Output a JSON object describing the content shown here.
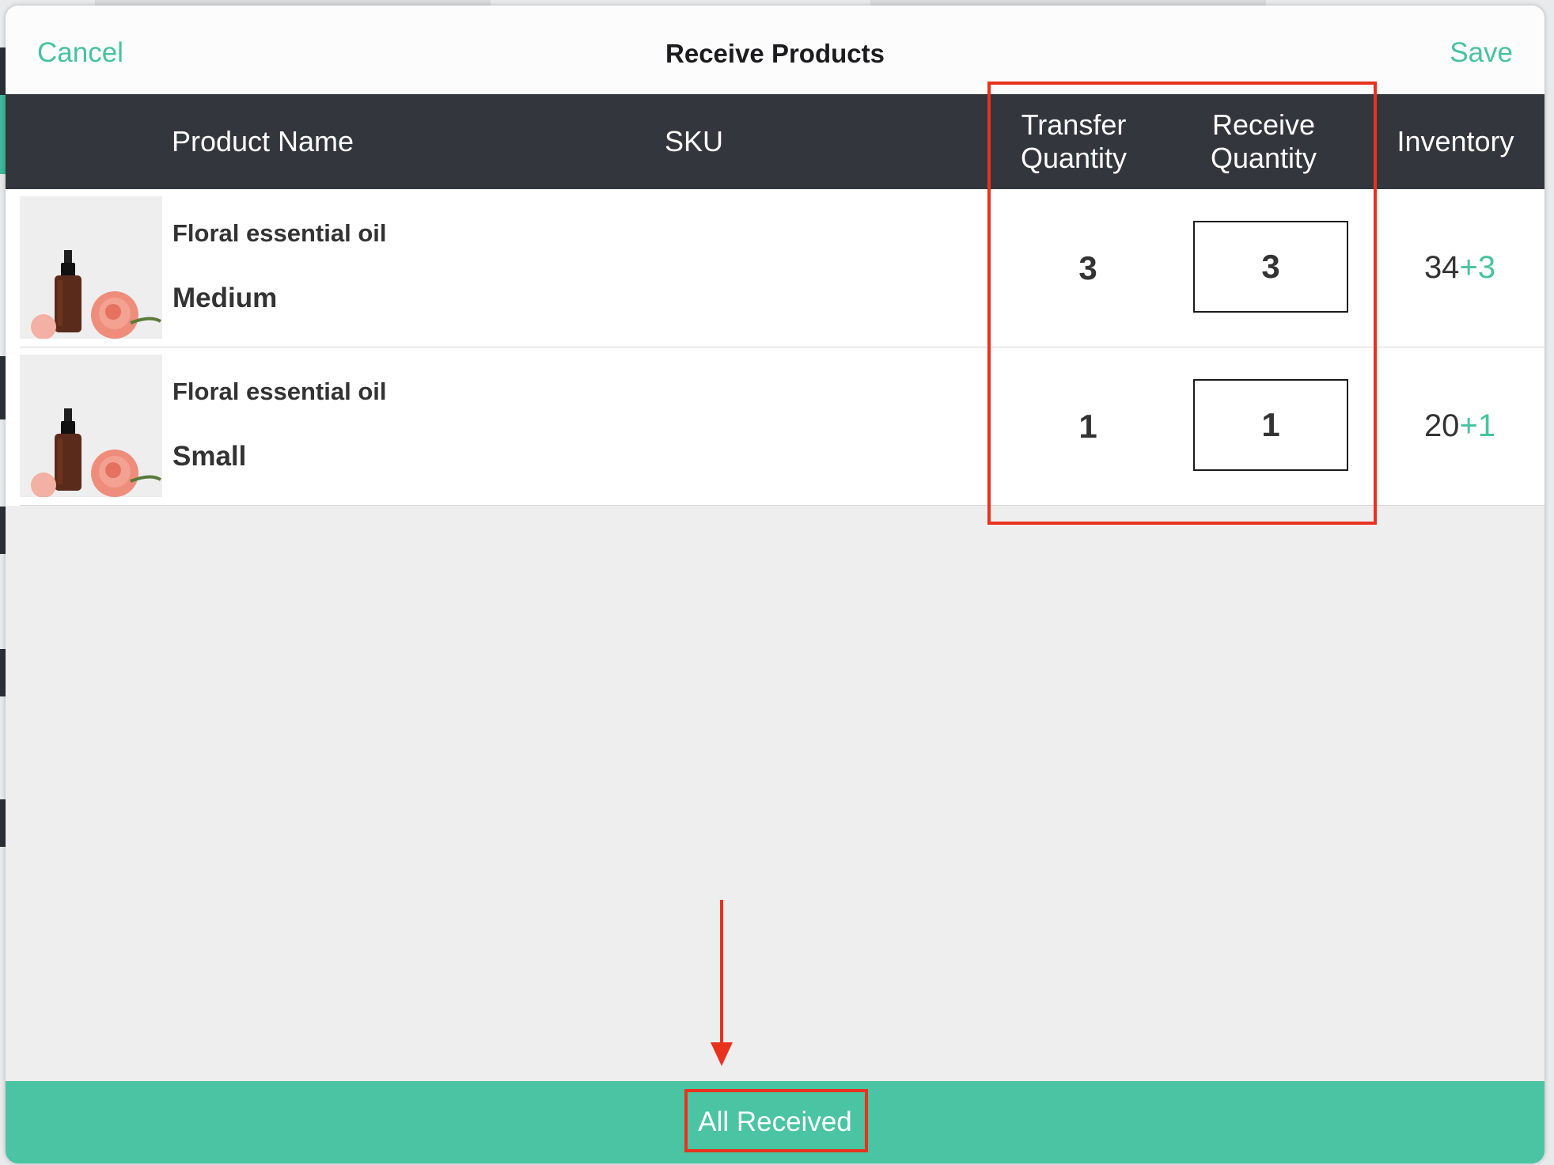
{
  "nav": {
    "cancel_label": "Cancel",
    "title": "Receive Products",
    "save_label": "Save"
  },
  "table": {
    "headers": {
      "product_name": "Product Name",
      "sku": "SKU",
      "transfer_quantity_line1": "Transfer",
      "transfer_quantity_line2": "Quantity",
      "receive_quantity_line1": "Receive",
      "receive_quantity_line2": "Quantity",
      "inventory": "Inventory"
    },
    "rows": [
      {
        "name": "Floral essential oil",
        "variant": "Medium",
        "sku": "",
        "transfer_quantity": "3",
        "receive_quantity": "3",
        "inventory_base": "34",
        "inventory_add": "+3"
      },
      {
        "name": "Floral essential oil",
        "variant": "Small",
        "sku": "",
        "transfer_quantity": "1",
        "receive_quantity": "1",
        "inventory_base": "20",
        "inventory_add": "+1"
      }
    ]
  },
  "footer": {
    "all_received_label": "All Received"
  },
  "colors": {
    "accent": "#48c2a1",
    "header_bg": "#33373d",
    "annotation": "#e8321e"
  }
}
